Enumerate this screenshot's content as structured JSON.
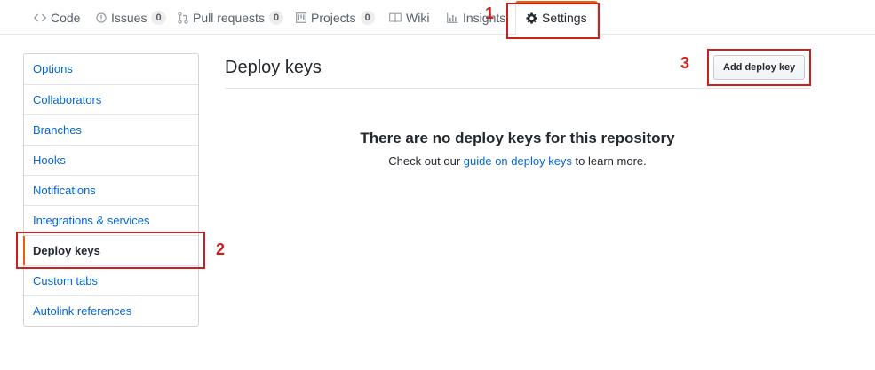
{
  "tabs": [
    {
      "label": "Code",
      "icon": "code-icon"
    },
    {
      "label": "Issues",
      "icon": "issue-icon",
      "count": "0"
    },
    {
      "label": "Pull requests",
      "icon": "pull-request-icon",
      "count": "0"
    },
    {
      "label": "Projects",
      "icon": "project-icon",
      "count": "0"
    },
    {
      "label": "Wiki",
      "icon": "book-icon"
    },
    {
      "label": "Insights",
      "icon": "graph-icon"
    },
    {
      "label": "Settings",
      "icon": "gear-icon",
      "selected": true
    }
  ],
  "sidebar": {
    "items": [
      {
        "label": "Options"
      },
      {
        "label": "Collaborators"
      },
      {
        "label": "Branches"
      },
      {
        "label": "Hooks"
      },
      {
        "label": "Notifications"
      },
      {
        "label": "Integrations & services"
      },
      {
        "label": "Deploy keys",
        "selected": true
      },
      {
        "label": "Custom tabs"
      },
      {
        "label": "Autolink references"
      }
    ]
  },
  "main": {
    "title": "Deploy keys",
    "add_button_label": "Add deploy key",
    "blankslate": {
      "heading": "There are no deploy keys for this repository",
      "text_before": "Check out our ",
      "link_text": "guide on deploy keys",
      "text_after": " to learn more."
    }
  },
  "annotations": {
    "step_1": "1",
    "step_2": "2",
    "step_3": "3"
  },
  "colors": {
    "accent": "#e36209",
    "link": "#0366d6",
    "annotation": "#c9211e"
  }
}
